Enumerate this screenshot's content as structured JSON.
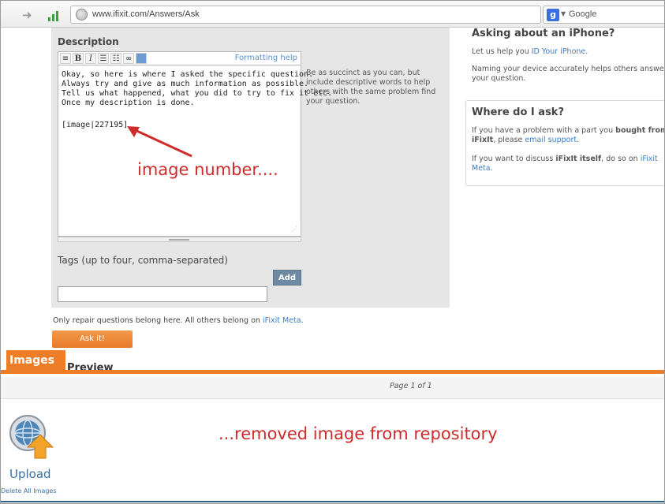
{
  "browser": {
    "url": "www.ifixit.com/Answers/Ask",
    "search_engine": "Google"
  },
  "form": {
    "description_label": "Description",
    "formatting_help": "Formatting help",
    "toolbar_buttons": [
      "paragraph",
      "bold",
      "italic",
      "bulleted-list",
      "numbered-list",
      "link",
      "image"
    ],
    "editor_text": "Okay, so here is where I asked the specific question.\nAlways try and give as much information as possible.\nTell us what happened, what you did to try to fix it etc.\nOnce my description is done.",
    "image_token": "[image|227195]",
    "help_text": "Be as succinct as you can, but include descriptive words to help others with the same problem find your question.",
    "tags_label": "Tags (up to four, comma-separated)",
    "add_button": "Add",
    "tags_value": "",
    "only_repair_prefix": "Only repair questions belong here. All others belong on",
    "only_repair_link": "iFixit Meta",
    "ask_button": "Ask it!"
  },
  "annotations": {
    "image_number": "image number....",
    "removed": "...removed image from repository"
  },
  "sidebar": {
    "iphone_heading": "Asking about an iPhone?",
    "iphone_line1_prefix": "Let us help you",
    "iphone_line1_link": "ID Your iPhone",
    "iphone_line2": "Naming your device accurately helps others answer your question.",
    "where_heading": "Where do I ask?",
    "where_p1_prefix": "If you have a problem with a part you",
    "where_p1_bold": "bought from iFixIt",
    "where_p1_mid": ", please",
    "where_p1_link": "email support",
    "where_p2_prefix": "If you want to discuss",
    "where_p2_bold": "iFixIt itself",
    "where_p2_mid": ", do so on",
    "where_p2_link": "iFixit Meta"
  },
  "images_panel": {
    "tab_label": "Images",
    "page_indicator": "Page 1 of 1",
    "upload_label": "Upload",
    "delete_all": "Delete All Images"
  },
  "colors": {
    "accent_orange": "#ee7d28",
    "link_blue": "#3c7fc0",
    "annotation_red": "#cf2b2b",
    "form_bg": "#e6e6e6"
  }
}
